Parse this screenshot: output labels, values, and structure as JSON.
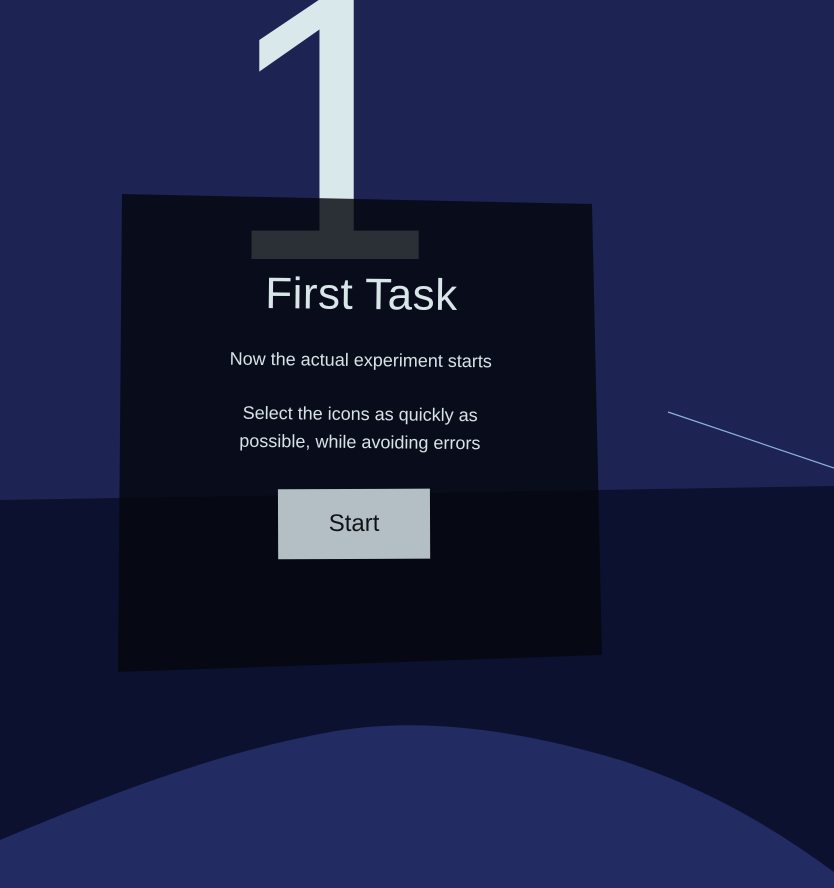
{
  "scene": {
    "sky_color": "#1d2352",
    "floor_color": "#0d1130",
    "mound_color": "#222b62",
    "panel_color": "#05070f",
    "ray_color": "#8fb0e0"
  },
  "countdown": {
    "number": "1"
  },
  "task_panel": {
    "title": "First Task",
    "subtitle": "Now the actual experiment starts",
    "instructions": "Select the icons as quickly as possible, while avoiding errors",
    "start_label": "Start"
  }
}
